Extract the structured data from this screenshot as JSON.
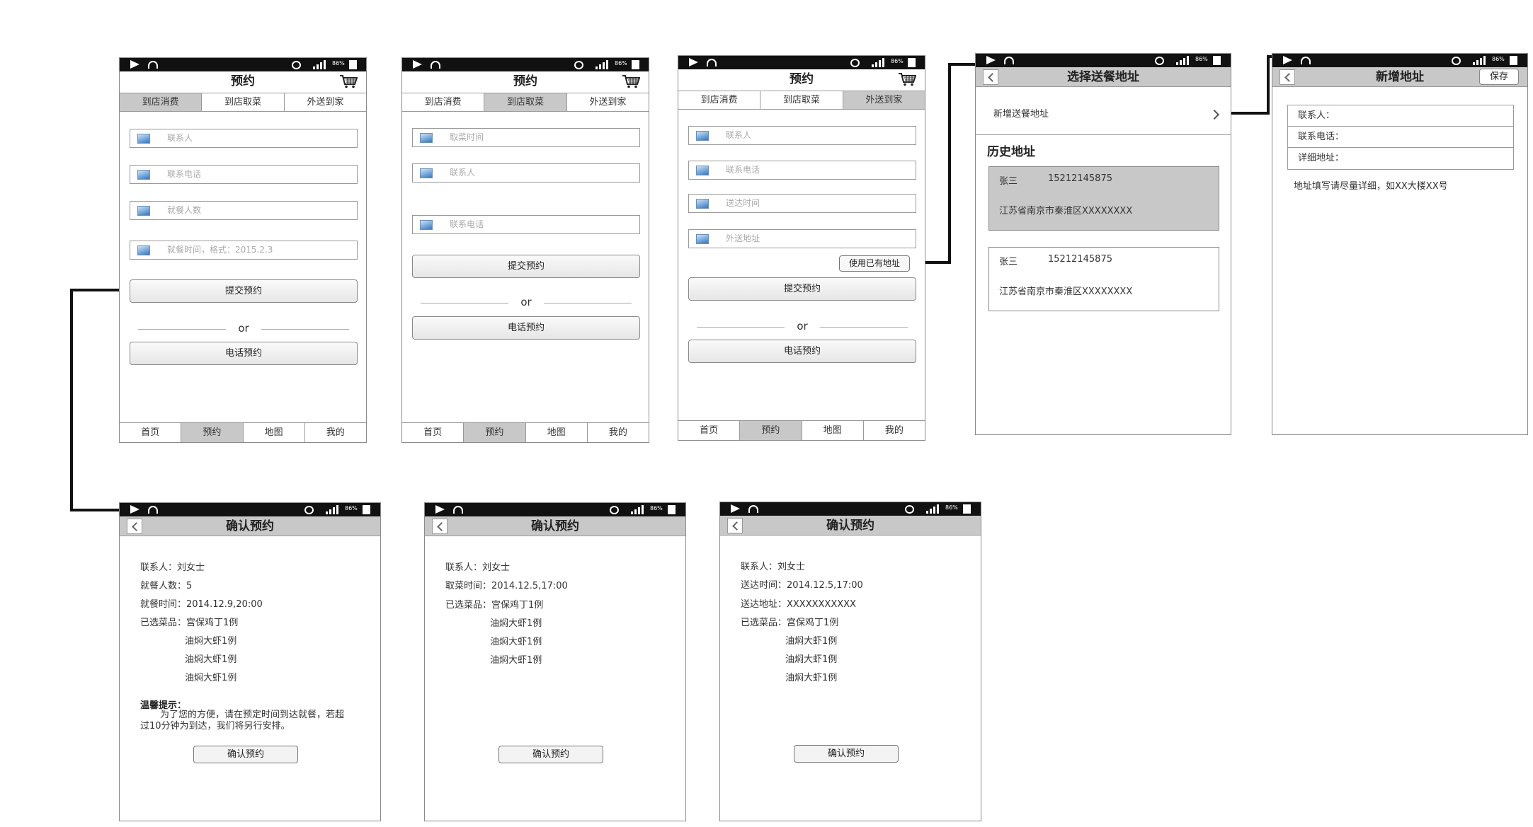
{
  "tabs": [
    "到店消费",
    "到店取菜",
    "外送到家"
  ],
  "bottom_nav": [
    "首页",
    "预约",
    "地图",
    "我的"
  ],
  "status_pct": "86%",
  "screens": {
    "s1": {
      "title": "预约",
      "fields": [
        "联系人",
        "联系电话",
        "就餐人数",
        "就餐时间，格式：2015.2.3"
      ],
      "submit": "提交预约",
      "or": "or",
      "phone": "电话预约"
    },
    "s2": {
      "title": "预约",
      "fields": [
        "取菜时间",
        "联系人",
        "联系电话"
      ],
      "submit": "提交预约",
      "or": "or",
      "phone": "电话预约"
    },
    "s3": {
      "title": "预约",
      "fields": [
        "联系人",
        "联系电话",
        "送达时间",
        "外送地址"
      ],
      "use_addr": "使用已有地址",
      "submit": "提交预约",
      "or": "or",
      "phone": "电话预约"
    },
    "s4": {
      "title": "选择送餐地址",
      "new_addr": "新增送餐地址",
      "section": "历史地址",
      "items": [
        {
          "name": "张三",
          "phone": "15212145875",
          "address": "江苏省南京市秦淮区XXXXXXXX"
        },
        {
          "name": "张三",
          "phone": "15212145875",
          "address": "江苏省南京市秦淮区XXXXXXXX"
        }
      ]
    },
    "s5": {
      "title": "新增地址",
      "save": "保存",
      "rows": [
        "联系人：",
        "联系电话：",
        "详细地址："
      ],
      "hint": "地址填写请尽量详细，如XX大楼XX号"
    },
    "c1": {
      "title": "确认预约",
      "contact": "联系人：刘女士",
      "people": "就餐人数：5",
      "time": "就餐时间：2014.12.9,20:00",
      "dishes_label": "已选菜品：宫保鸡丁1例",
      "dishes": [
        "油焖大虾1例",
        "油焖大虾1例",
        "油焖大虾1例"
      ],
      "tip_title": "温馨提示：",
      "tip_1": "为了您的方便，请在预定时间到达就餐，若超",
      "tip_2": "过10分钟为到达，我们将另行安排。",
      "confirm": "确认预约"
    },
    "c2": {
      "title": "确认预约",
      "contact": "联系人：刘女士",
      "time": "取菜时间：2014.12.5,17:00",
      "dishes_label": "已选菜品：宫保鸡丁1例",
      "dishes": [
        "油焖大虾1例",
        "油焖大虾1例",
        "油焖大虾1例"
      ],
      "confirm": "确认预约"
    },
    "c3": {
      "title": "确认预约",
      "contact": "联系人：刘女士",
      "time": "送达时间：2014.12.5,17:00",
      "address": "送达地址：XXXXXXXXXXX",
      "dishes_label": "已选菜品：宫保鸡丁1例",
      "dishes": [
        "油焖大虾1例",
        "油焖大虾1例",
        "油焖大虾1例"
      ],
      "confirm": "确认预约"
    }
  }
}
